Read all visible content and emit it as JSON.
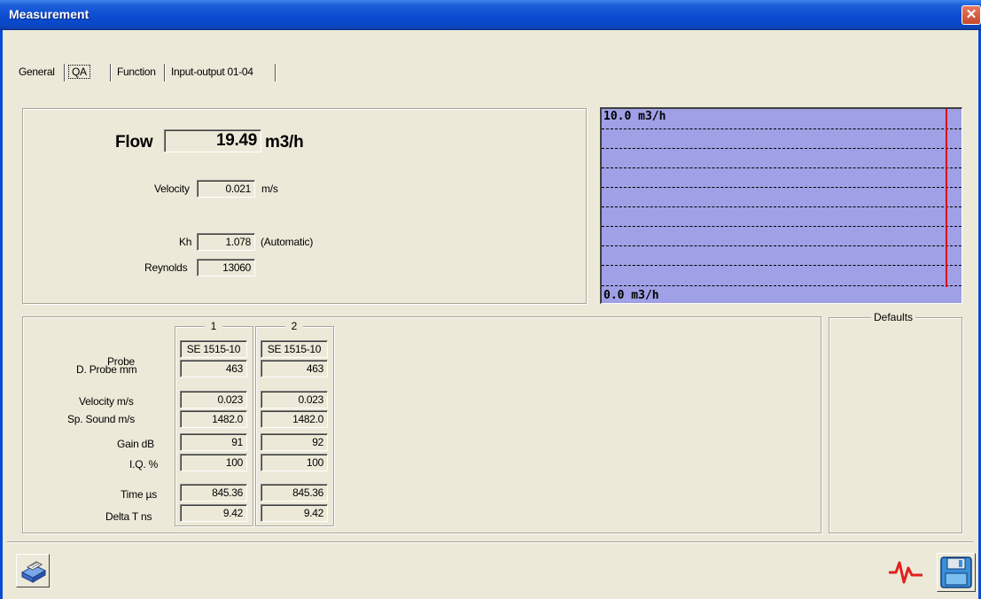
{
  "window": {
    "title": "Measurement",
    "close": "✕"
  },
  "tabs": [
    {
      "label": "General",
      "active": false
    },
    {
      "label": "QA",
      "active": true
    },
    {
      "label": "Function",
      "active": false
    },
    {
      "label": "Input-output 01-04",
      "active": false
    }
  ],
  "summary": {
    "flow_label": "Flow",
    "flow_value": "19.49",
    "flow_unit": "m3/h",
    "velocity_label": "Velocity",
    "velocity_value": "0.021",
    "velocity_unit": "m/s",
    "kh_label": "Kh",
    "kh_value": "1.078",
    "kh_note": "(Automatic)",
    "reynolds_label": "Reynolds",
    "reynolds_value": "13060"
  },
  "trend": {
    "top_label": "10.0 m3/h",
    "bottom_label": "0.0 m3/h",
    "background": "#a0a0e6",
    "marker_color": "#e00000"
  },
  "probes": {
    "columns": [
      "1",
      "2"
    ],
    "rows": [
      {
        "label": "Probe",
        "values": [
          "SE 1515-10",
          "SE 1515-10"
        ]
      },
      {
        "label": "D. Probe mm",
        "values": [
          "463",
          "463"
        ]
      },
      {
        "label": "Velocity m/s",
        "values": [
          "0.023",
          "0.023"
        ]
      },
      {
        "label": "Sp. Sound m/s",
        "values": [
          "1482.0",
          "1482.0"
        ]
      },
      {
        "label": "Gain dB",
        "values": [
          "91",
          "92"
        ]
      },
      {
        "label": "I.Q. %",
        "values": [
          "100",
          "100"
        ]
      },
      {
        "label": "Time µs",
        "values": [
          "845.36",
          "845.36"
        ]
      },
      {
        "label": "Delta T ns",
        "values": [
          "9.42",
          "9.42"
        ]
      }
    ]
  },
  "defaults": {
    "title": "Defaults"
  },
  "toolbar": {
    "print_icon": "printer-icon",
    "waveform_icon": "waveform-icon",
    "save_icon": "floppy-disk-icon"
  }
}
